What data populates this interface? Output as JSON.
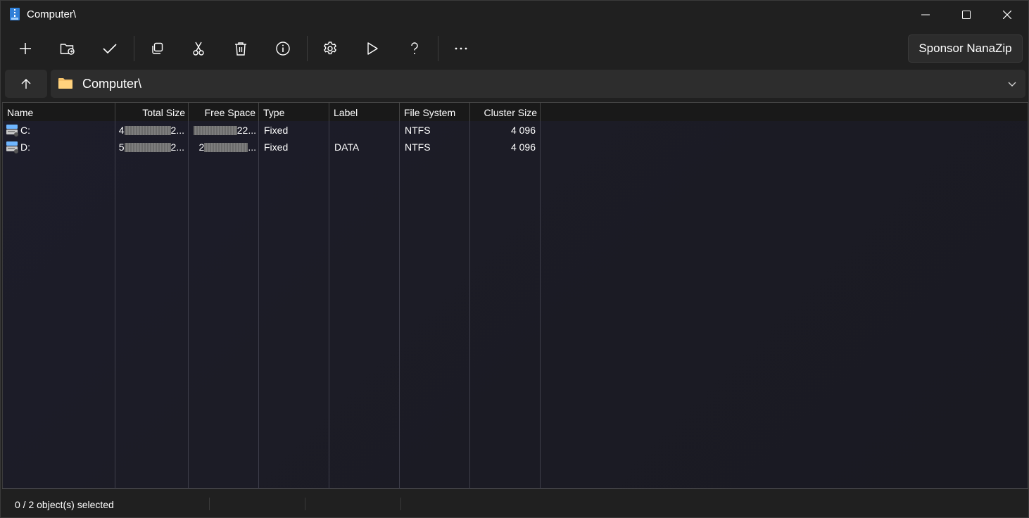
{
  "window": {
    "title": "Computer\\"
  },
  "toolbar": {
    "buttons": [
      {
        "name": "add-icon"
      },
      {
        "name": "extract-icon"
      },
      {
        "name": "test-icon"
      },
      {
        "name": "copy-icon"
      },
      {
        "name": "move-icon"
      },
      {
        "name": "delete-icon"
      },
      {
        "name": "info-icon"
      },
      {
        "name": "settings-icon"
      },
      {
        "name": "play-icon"
      },
      {
        "name": "help-icon"
      },
      {
        "name": "more-icon"
      }
    ],
    "sponsor_label": "Sponsor NanaZip"
  },
  "address": {
    "path": "Computer\\"
  },
  "columns": [
    "Name",
    "Total Size",
    "Free Space",
    "Type",
    "Label",
    "File System",
    "Cluster Size"
  ],
  "rows": [
    {
      "name": "C:",
      "total_size_start": "4",
      "total_size_end": "2...",
      "free_space_start": "",
      "free_space_end": "22...",
      "type": "Fixed",
      "label": "",
      "file_system": "NTFS",
      "cluster_size": "4 096"
    },
    {
      "name": "D:",
      "total_size_start": "5",
      "total_size_end": "2...",
      "free_space_start": "2",
      "free_space_end": "...",
      "type": "Fixed",
      "label": "DATA",
      "file_system": "NTFS",
      "cluster_size": "4 096"
    }
  ],
  "status": {
    "selection": "0 / 2 object(s) selected"
  },
  "colors": {
    "background": "#202020",
    "list_background": "#1c1c26",
    "accent_folder": "#f5c26b"
  }
}
